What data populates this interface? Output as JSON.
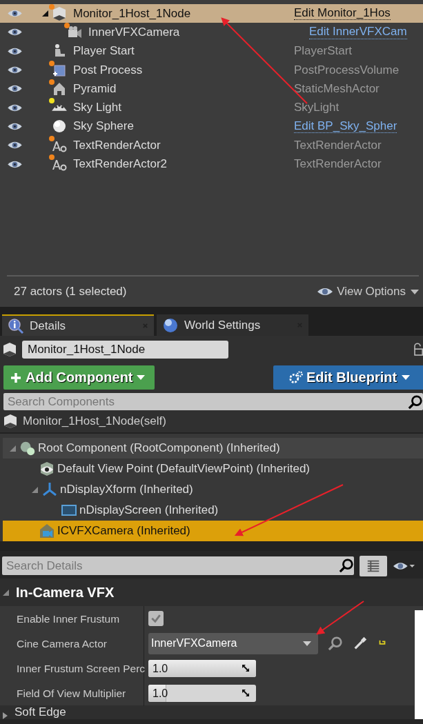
{
  "outliner": {
    "rows": [
      {
        "name": "Monitor_1Host_1Node",
        "kind": "blueprint",
        "color": "#f0841c",
        "type": "Edit Monitor_1Hos",
        "type_link": true,
        "selected": true,
        "expanded": true,
        "children": [
          {
            "name": "InnerVFXCamera",
            "kind": "camera",
            "color": "#f0841c",
            "type": "Edit InnerVFXCam",
            "type_link": true,
            "selected": false
          }
        ]
      },
      {
        "name": "Player Start",
        "kind": "player-start",
        "type": "PlayerStart",
        "type_link": false,
        "selected": false
      },
      {
        "name": "Post Process",
        "kind": "post-process",
        "color": "#f0841c",
        "type": "PostProcessVolume",
        "type_link": false,
        "selected": false
      },
      {
        "name": "Pyramid",
        "kind": "static-mesh",
        "color": "#f0841c",
        "type": "StaticMeshActor",
        "type_link": false,
        "selected": false
      },
      {
        "name": "Sky Light",
        "kind": "sky-light",
        "color": "#f0e020",
        "type": "SkyLight",
        "type_link": false,
        "selected": false
      },
      {
        "name": "Sky Sphere",
        "kind": "sky-sphere",
        "type": "Edit BP_Sky_Spher",
        "type_link": true,
        "selected": false
      },
      {
        "name": "TextRenderActor",
        "kind": "text-render",
        "color": "#f0841c",
        "type": "TextRenderActor",
        "type_link": false,
        "selected": false
      },
      {
        "name": "TextRenderActor2",
        "kind": "text-render",
        "color": "#f0841c",
        "type": "TextRenderActor",
        "type_link": false,
        "selected": false
      }
    ],
    "status": "27 actors (1 selected)",
    "view_options": "View Options"
  },
  "tabs": [
    {
      "label": "Details",
      "kind": "details",
      "selected": true
    },
    {
      "label": "World Settings",
      "kind": "world",
      "selected": false
    }
  ],
  "details": {
    "actor_name": "Monitor_1Host_1Node",
    "add_component": "Add Component",
    "edit_blueprint": "Edit Blueprint",
    "search_components": {
      "placeholder": "Search Components"
    },
    "self_label": "Monitor_1Host_1Node(self)",
    "components": [
      {
        "name": "Root Component (RootComponent) (Inherited)",
        "kind": "root",
        "selected": false,
        "expanded": true,
        "children": [
          {
            "name": "Default View Point (DefaultViewPoint) (Inherited)",
            "kind": "view-point",
            "selected": false
          },
          {
            "name": "nDisplayXform (Inherited)",
            "kind": "xform",
            "selected": false,
            "expanded": true,
            "children": [
              {
                "name": "nDisplayScreen (Inherited)",
                "kind": "screen",
                "selected": false
              }
            ]
          },
          {
            "name": "ICVFXCamera (Inherited)",
            "kind": "camera",
            "selected": true
          }
        ]
      }
    ],
    "search_details": {
      "placeholder": "Search Details"
    },
    "sections": [
      {
        "title": "In-Camera VFX",
        "expanded": true,
        "properties": [
          {
            "label": "Enable Inner Frustum",
            "kind": "checkbox",
            "checked": true
          },
          {
            "label": "Cine Camera Actor",
            "kind": "picker",
            "value": "InnerVFXCamera"
          },
          {
            "label": "Inner Frustum Screen Perc",
            "kind": "number",
            "value": "1.0",
            "level": 1
          },
          {
            "label": "Field Of View Multiplier",
            "kind": "number",
            "value": "1.0",
            "level": 0.16
          }
        ]
      },
      {
        "title": "Soft Edge",
        "expanded": false
      }
    ]
  }
}
